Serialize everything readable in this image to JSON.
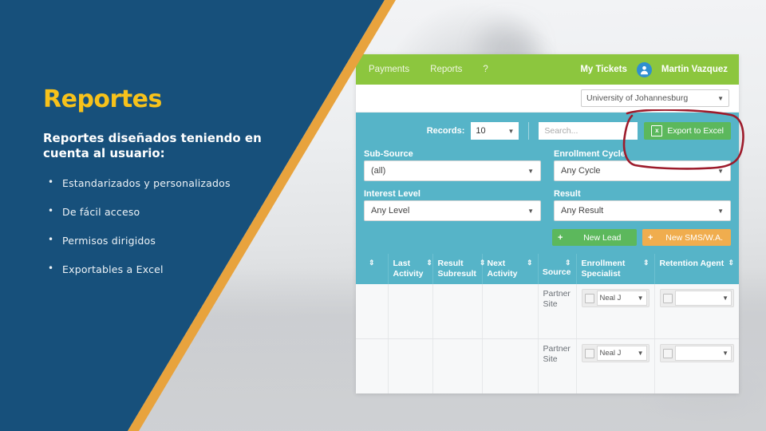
{
  "slide": {
    "title": "Reportes",
    "subtitle": "Reportes diseñados teniendo en cuenta al usuario:",
    "bullets": [
      "Estandarizados y personalizados",
      "De fácil acceso",
      "Permisos dirigidos",
      "Exportables a Excel"
    ],
    "colors": {
      "panel_blue": "#17507b",
      "accent_orange": "#e8a33d",
      "title_yellow": "#f7c21b",
      "annotation_red": "#a01828"
    }
  },
  "app": {
    "nav": {
      "links": [
        "Payments",
        "Reports",
        "?"
      ],
      "my_tickets": "My Tickets",
      "user_name": "Martin Vazquez",
      "avatar_icon": "user-icon"
    },
    "subbar": {
      "org_select_value": "University of Johannesburg",
      "caret_icon": "chevron-down-icon"
    },
    "toolbar": {
      "records_label": "Records:",
      "records_value": "10",
      "search_placeholder": "Search...",
      "export_label": "Export to Excel",
      "export_icon": "excel-file-icon"
    },
    "filters": [
      {
        "label": "Sub-Source",
        "value": "(all)"
      },
      {
        "label": "Enrollment Cycle",
        "value": "Any Cycle"
      },
      {
        "label": "Interest Level",
        "value": "Any Level"
      },
      {
        "label": "Result",
        "value": "Any Result"
      }
    ],
    "actions": [
      {
        "label": "New Lead",
        "icon": "plus-icon",
        "color": "#5cb85c"
      },
      {
        "label": "New SMS/W.A.",
        "icon": "plus-icon",
        "color": "#f0ad4e"
      }
    ],
    "table": {
      "sort_icon": "sort-updown-icon",
      "columns": [
        "",
        "Last Activity",
        "Result Subresult",
        "Next Activity",
        "Source",
        "Enrollment Specialist",
        "Retention Agent"
      ],
      "rows": [
        {
          "col1": "",
          "last_activity": "",
          "result_subresult": "",
          "next_activity": "",
          "source": "Partner Site",
          "enrollment_specialist": "Neal J",
          "retention_agent": ""
        },
        {
          "col1": "",
          "last_activity": "",
          "result_subresult": "",
          "next_activity": "",
          "source": "Partner Site",
          "enrollment_specialist": "Neal J",
          "retention_agent": ""
        }
      ]
    }
  },
  "annotation": {
    "shape": "hand-drawn-red-circle",
    "targets": "Export to Excel button"
  }
}
